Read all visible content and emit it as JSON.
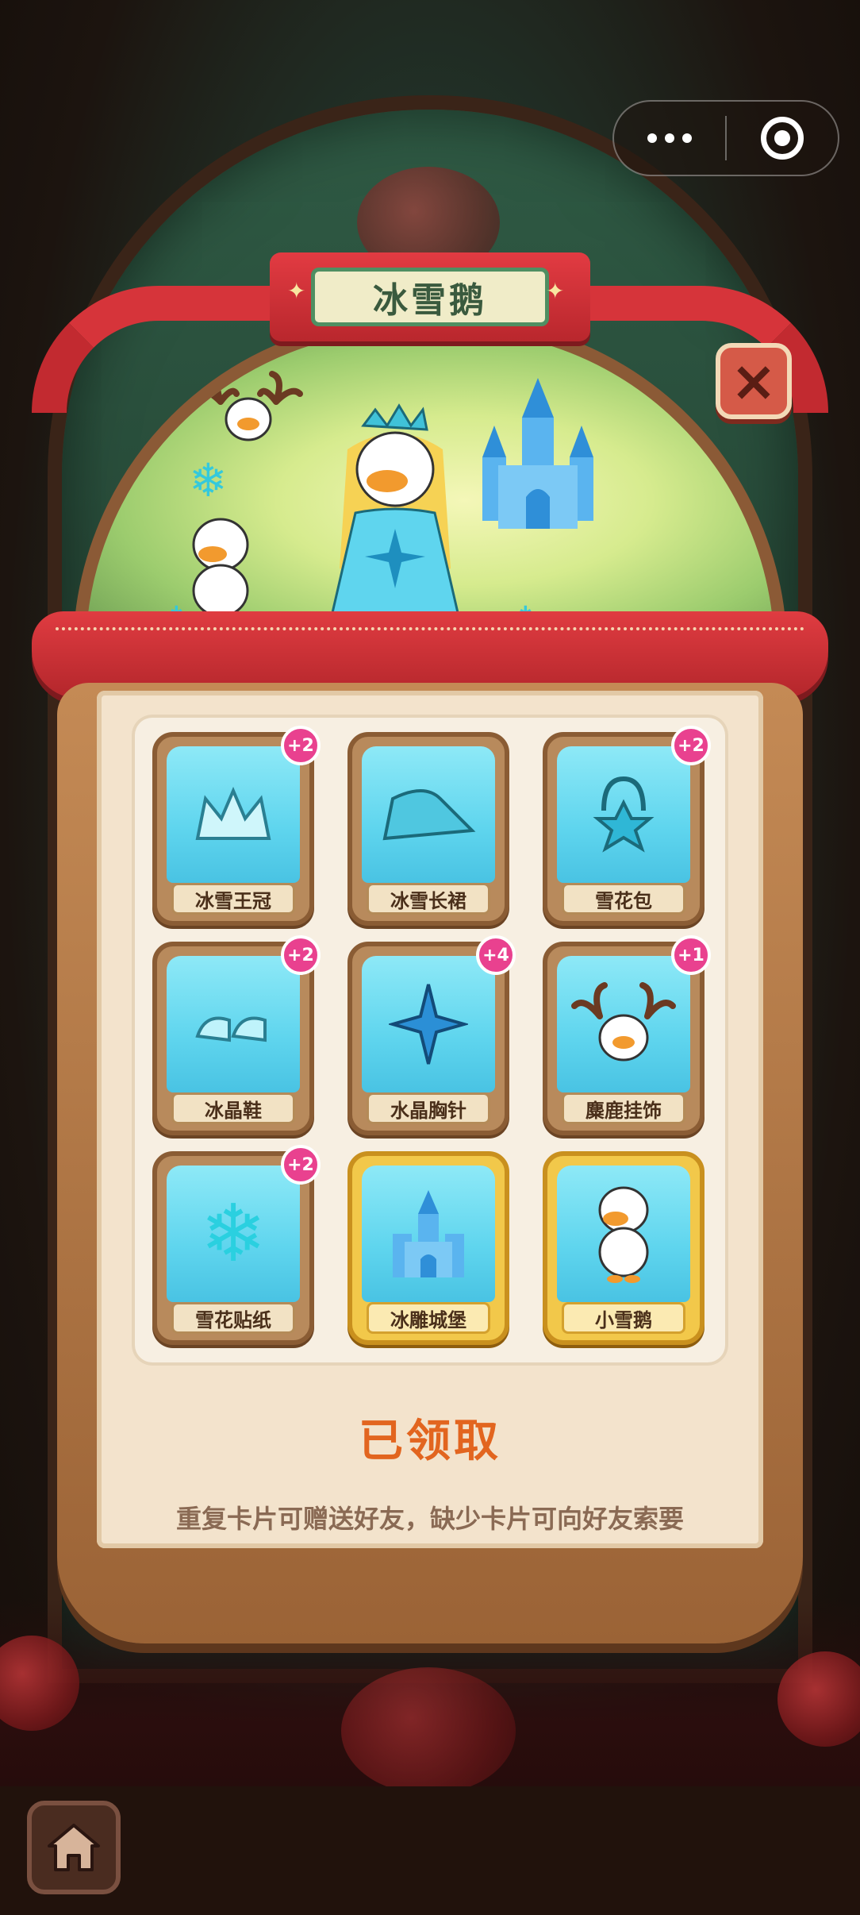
{
  "capsule": {
    "more_icon": "more-dots-icon",
    "close_icon": "target-circle-icon"
  },
  "title": "冰雪鹅",
  "close_button": "×",
  "cards": [
    {
      "name": "冰雪王冠",
      "badge": "+2",
      "tier": "normal",
      "icon": "crown-icon"
    },
    {
      "name": "冰雪长裙",
      "badge": "",
      "tier": "normal",
      "icon": "dress-icon"
    },
    {
      "name": "雪花包",
      "badge": "+2",
      "tier": "normal",
      "icon": "bag-icon"
    },
    {
      "name": "冰晶鞋",
      "badge": "+2",
      "tier": "normal",
      "icon": "shoes-icon"
    },
    {
      "name": "水晶胸针",
      "badge": "+4",
      "tier": "normal",
      "icon": "brooch-icon"
    },
    {
      "name": "麋鹿挂饰",
      "badge": "+1",
      "tier": "normal",
      "icon": "reindeer-icon"
    },
    {
      "name": "雪花贴纸",
      "badge": "+2",
      "tier": "normal",
      "icon": "snowflake-icon"
    },
    {
      "name": "冰雕城堡",
      "badge": "",
      "tier": "gold",
      "icon": "castle-icon"
    },
    {
      "name": "小雪鹅",
      "badge": "",
      "tier": "gold",
      "icon": "goose-icon"
    }
  ],
  "status": "已领取",
  "hint": "重复卡片可赠送好友，缺少卡片可向好友索要",
  "colors": {
    "accent_red": "#d6343a",
    "status_orange": "#e2651f",
    "badge_pink": "#e9418f",
    "card_cyan": "#5fd5ee",
    "gold": "#f2c84a"
  }
}
